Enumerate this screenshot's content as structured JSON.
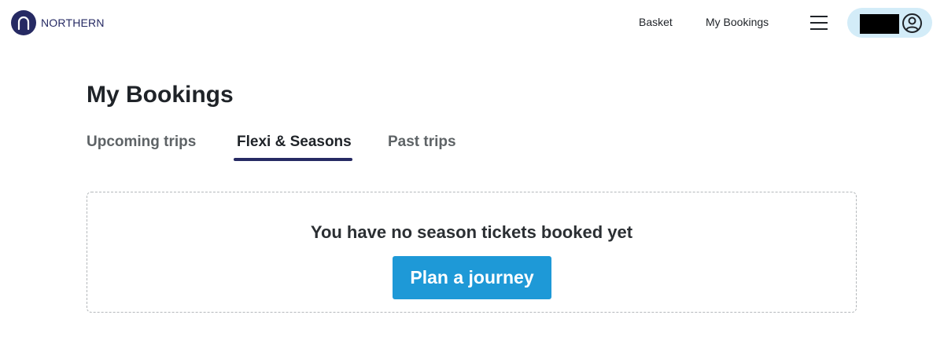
{
  "header": {
    "logo_text": "NORTHERN",
    "nav": {
      "basket": "Basket",
      "my_bookings": "My Bookings"
    },
    "menu_icon": "hamburger-menu-icon",
    "account_icon": "user-circle-icon"
  },
  "main": {
    "title": "My Bookings",
    "tabs": [
      {
        "label": "Upcoming trips",
        "active": false
      },
      {
        "label": "Flexi & Seasons",
        "active": true
      },
      {
        "label": "Past trips",
        "active": false
      }
    ],
    "empty_state": {
      "message": "You have no season tickets booked yet",
      "button_label": "Plan a journey"
    }
  },
  "colors": {
    "brand_navy": "#262a63",
    "accent_blue": "#1e99d7",
    "account_pill": "#d3ecf8"
  }
}
